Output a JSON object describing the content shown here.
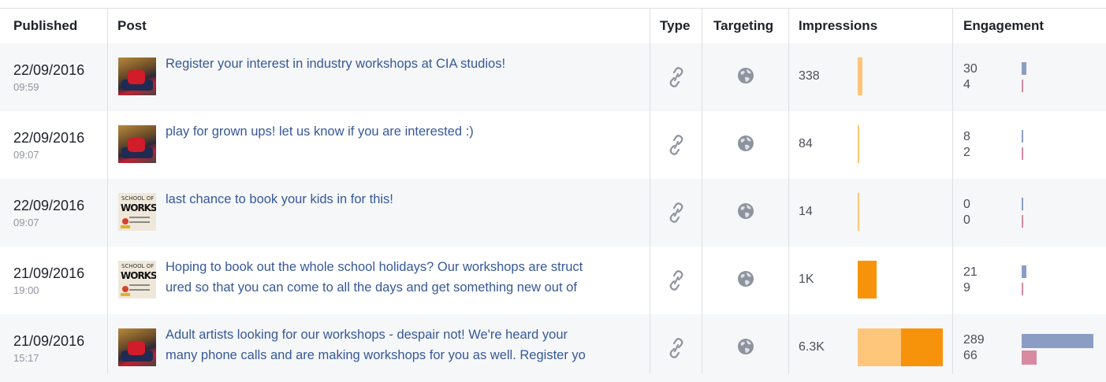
{
  "header": {
    "published": "Published",
    "post": "Post",
    "type": "Type",
    "targeting": "Targeting",
    "impressions": "Impressions",
    "engagement": "Engagement"
  },
  "colors": {
    "link": "#365899",
    "impressions_light": "#fdc67a",
    "impressions_dark": "#f7930b",
    "engagement_clicks": "#8b9dc3",
    "engagement_reactions": "#d78aa0"
  },
  "rows": [
    {
      "date": "22/09/2016",
      "time": "09:59",
      "thumb": "photo",
      "post_line1": "Register your interest in industry workshops at CIA studios!",
      "post_line2": "",
      "type_icon": "link-icon",
      "targeting_icon": "globe-icon",
      "impressions": "338",
      "imp_value": 338,
      "eng_top": "30",
      "eng_bottom": "4"
    },
    {
      "date": "22/09/2016",
      "time": "09:07",
      "thumb": "photo",
      "post_line1": "play for grown ups! let us know if you are interested :)",
      "post_line2": "",
      "type_icon": "link-icon",
      "targeting_icon": "globe-icon",
      "impressions": "84",
      "imp_value": 84,
      "eng_top": "8",
      "eng_bottom": "2"
    },
    {
      "date": "22/09/2016",
      "time": "09:07",
      "thumb": "poster",
      "post_line1": "last chance to book your kids in for this!",
      "post_line2": "",
      "type_icon": "link-icon",
      "targeting_icon": "globe-icon",
      "impressions": "14",
      "imp_value": 14,
      "eng_top": "0",
      "eng_bottom": "0"
    },
    {
      "date": "21/09/2016",
      "time": "19:00",
      "thumb": "poster",
      "post_line1": "Hoping to book out the whole school holidays? Our workshops are struct",
      "post_line2": "ured so that you can come to all the days and get something new out of",
      "type_icon": "link-icon",
      "targeting_icon": "globe-icon",
      "impressions": "1K",
      "imp_value": 1000,
      "eng_top": "21",
      "eng_bottom": "9"
    },
    {
      "date": "21/09/2016",
      "time": "15:17",
      "thumb": "photo",
      "post_line1": "Adult artists looking for our workshops - despair not! We're heard your",
      "post_line2": "many phone calls and are making workshops for you as well. Register yo",
      "type_icon": "link-icon",
      "targeting_icon": "globe-icon",
      "impressions": "6.3K",
      "imp_value": 6300,
      "eng_top": "289",
      "eng_bottom": "66"
    }
  ]
}
